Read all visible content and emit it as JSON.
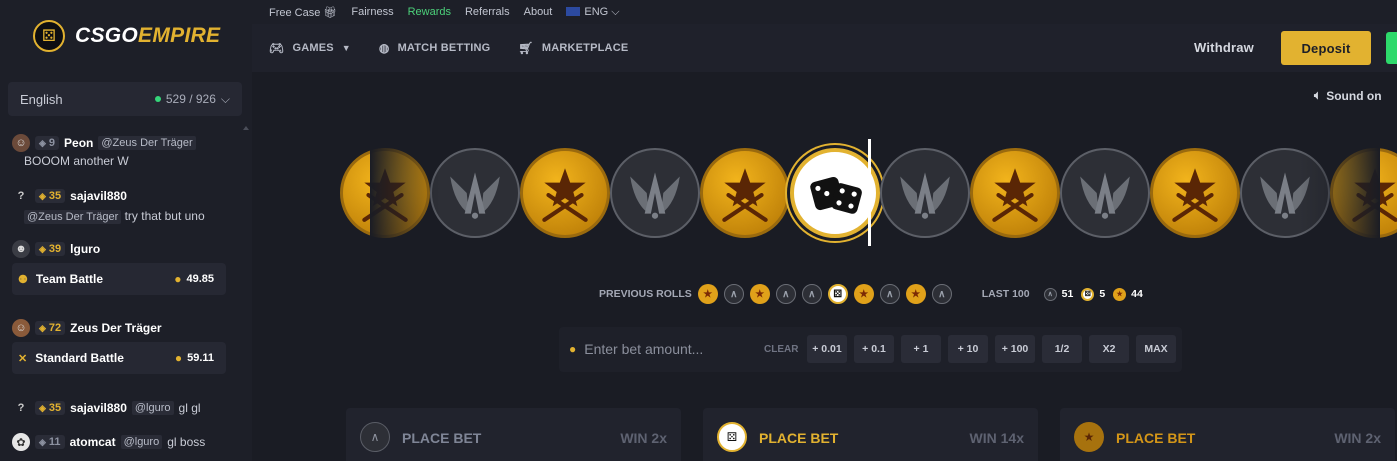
{
  "brand": {
    "name_part1": "CSGO",
    "name_part2": "EMPIRE"
  },
  "topnav": {
    "links": [
      "Free Case",
      "Fairness",
      "Rewards",
      "Referrals",
      "About"
    ],
    "language": "ENG"
  },
  "mainnav": {
    "items": [
      "GAMES",
      "MATCH BETTING",
      "MARKETPLACE"
    ],
    "withdraw": "Withdraw",
    "deposit": "Deposit"
  },
  "sidebar": {
    "language": "English",
    "online": "529 / 926"
  },
  "chat": [
    {
      "level": "9",
      "user": "Peon",
      "mention": "@Zeus Der Träger",
      "text": "BOOOM another W"
    },
    {
      "level": "35",
      "user": "sajavil880",
      "mention": "@Zeus Der Träger",
      "text": "try that but uno"
    },
    {
      "level": "39",
      "user": "lguro",
      "battle": "Team Battle",
      "amount": "49.85"
    },
    {
      "level": "72",
      "user": "Zeus Der Träger",
      "battle": "Standard Battle",
      "amount": "59.11"
    },
    {
      "level": "35",
      "user": "sajavil880",
      "mention": "@lguro",
      "text": "gl gl"
    },
    {
      "level": "11",
      "user": "atomcat",
      "mention": "@lguro",
      "text": "gl boss"
    }
  ],
  "game": {
    "sound": "Sound on",
    "previous_rolls_label": "PREVIOUS ROLLS",
    "previous_rolls": [
      "t",
      "ct",
      "t",
      "ct",
      "ct",
      "bonus",
      "t",
      "ct",
      "t",
      "ct"
    ],
    "last100_label": "LAST 100",
    "last100": {
      "ct": "51",
      "bonus": "5",
      "t": "44"
    },
    "roller": [
      "t",
      "ct",
      "t",
      "ct",
      "t",
      "bonus",
      "ct",
      "t",
      "ct",
      "t",
      "ct",
      "t"
    ]
  },
  "bet": {
    "placeholder": "Enter bet amount...",
    "clear": "CLEAR",
    "buttons": [
      "+ 0.01",
      "+ 0.1",
      "+ 1",
      "+ 10",
      "+ 100",
      "1/2",
      "X2",
      "MAX"
    ]
  },
  "panels": [
    {
      "label": "PLACE BET",
      "win": "WIN 2x",
      "color": "#7f8596"
    },
    {
      "label": "PLACE BET",
      "win": "WIN 14x",
      "color": "#e2b230"
    },
    {
      "label": "PLACE BET",
      "win": "WIN 2x",
      "color": "#d49618"
    }
  ],
  "colors": {
    "accent": "#e2b230",
    "online": "#35d67a",
    "rewards": "#4cd07a"
  }
}
